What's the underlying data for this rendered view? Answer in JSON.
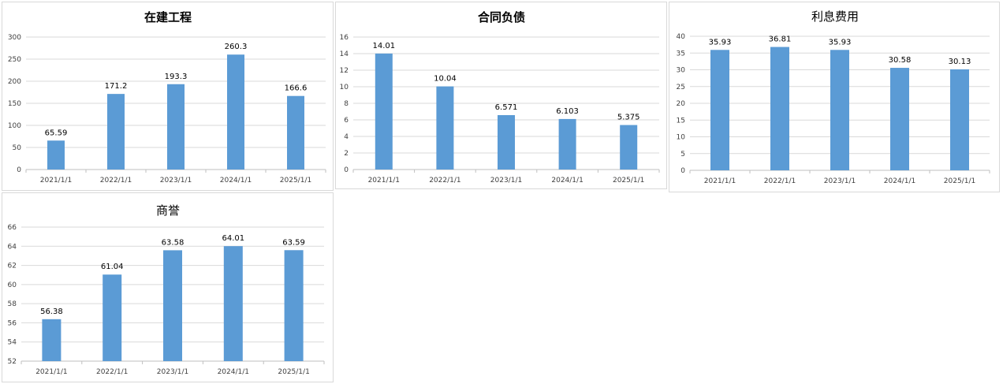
{
  "colors": {
    "bar": "#5b9bd5",
    "grid": "#d9d9d9",
    "axis": "#bfbfbf"
  },
  "chart_data": [
    {
      "type": "bar",
      "title": "在建工程",
      "title_bold": true,
      "categories": [
        "2021/1/1",
        "2022/1/1",
        "2023/1/1",
        "2024/1/1",
        "2025/1/1"
      ],
      "values": [
        65.59,
        171.2,
        193.3,
        260.3,
        166.6
      ],
      "value_labels": [
        "65.59",
        "171.2",
        "193.3",
        "260.3",
        "166.6"
      ],
      "ylim": [
        0,
        300
      ],
      "yticks": [
        0,
        50,
        100,
        150,
        200,
        250,
        300
      ],
      "grid": true,
      "legend": "none"
    },
    {
      "type": "bar",
      "title": "合同负债",
      "title_bold": true,
      "categories": [
        "2021/1/1",
        "2022/1/1",
        "2023/1/1",
        "2024/1/1",
        "2025/1/1"
      ],
      "values": [
        14.01,
        10.04,
        6.571,
        6.103,
        5.375
      ],
      "value_labels": [
        "14.01",
        "10.04",
        "6.571",
        "6.103",
        "5.375"
      ],
      "ylim": [
        0,
        16
      ],
      "yticks": [
        0,
        2,
        4,
        6,
        8,
        10,
        12,
        14,
        16
      ],
      "grid": true,
      "legend": "none"
    },
    {
      "type": "bar",
      "title": "利息费用",
      "title_bold": false,
      "categories": [
        "2021/1/1",
        "2022/1/1",
        "2023/1/1",
        "2024/1/1",
        "2025/1/1"
      ],
      "values": [
        35.93,
        36.81,
        35.93,
        30.58,
        30.13
      ],
      "value_labels": [
        "35.93",
        "36.81",
        "35.93",
        "30.58",
        "30.13"
      ],
      "ylim": [
        0,
        40
      ],
      "yticks": [
        0,
        5,
        10,
        15,
        20,
        25,
        30,
        35,
        40
      ],
      "grid": true,
      "legend": "none"
    },
    {
      "type": "bar",
      "title": "商誉",
      "title_bold": false,
      "categories": [
        "2021/1/1",
        "2022/1/1",
        "2023/1/1",
        "2024/1/1",
        "2025/1/1"
      ],
      "values": [
        56.38,
        61.04,
        63.58,
        64.01,
        63.59
      ],
      "value_labels": [
        "56.38",
        "61.04",
        "63.58",
        "64.01",
        "63.59"
      ],
      "ylim": [
        52,
        66
      ],
      "yticks": [
        52,
        54,
        56,
        58,
        60,
        62,
        64,
        66
      ],
      "grid": true,
      "legend": "none"
    }
  ]
}
